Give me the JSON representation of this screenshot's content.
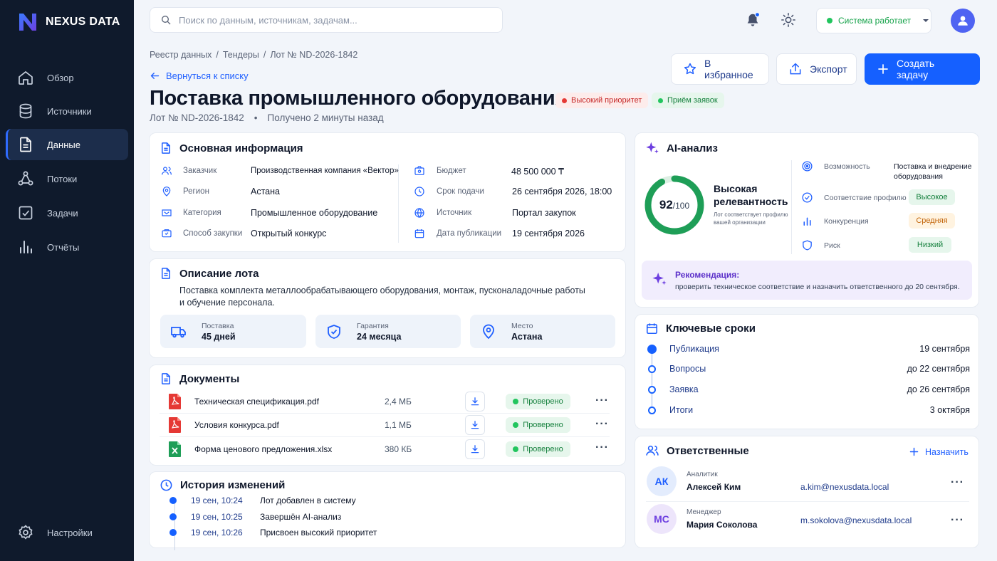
{
  "app": {
    "name": "NEXUS DATA"
  },
  "sidebar": {
    "items": [
      {
        "label": "Обзор",
        "icon": "home-icon"
      },
      {
        "label": "Источники",
        "icon": "database-icon"
      },
      {
        "label": "Данные",
        "icon": "document-icon",
        "active": true
      },
      {
        "label": "Потоки",
        "icon": "flow-icon"
      },
      {
        "label": "Задачи",
        "icon": "checkbox-icon"
      },
      {
        "label": "Отчёты",
        "icon": "bar-chart-icon"
      }
    ],
    "settings_label": "Настройки"
  },
  "topbar": {
    "search_placeholder": "Поиск по данным, источникам, задачам...",
    "system_status": "Система работает"
  },
  "header": {
    "breadcrumb": [
      "Реестр данных",
      "/",
      "Тендеры",
      "/",
      "Лот № ND-2026-1842"
    ],
    "back_label": "Вернуться к списку",
    "title": "Поставка промышленного оборудования",
    "priority_badge": "Высокий приоритет",
    "status_badge": "Приём заявок",
    "lot_number": "Лот № ND-2026-1842",
    "separator": "•",
    "received": "Получено 2 минуты назад",
    "favorite_label": "В избранное",
    "export_label": "Экспорт",
    "create_task_label": "Создать задачу"
  },
  "basic_info": {
    "title": "Основная информация",
    "left": [
      {
        "label": "Заказчик",
        "value": "Производственная компания «Вектор»",
        "icon": "user-icon"
      },
      {
        "label": "Регион",
        "value": "Астана",
        "icon": "location-icon"
      },
      {
        "label": "Категория",
        "value": "Промышленное оборудование",
        "icon": "category-icon"
      },
      {
        "label": "Способ закупки",
        "value": "Открытый конкурс",
        "icon": "procurement-icon"
      }
    ],
    "right": [
      {
        "label": "Бюджет",
        "value": "48 500 000 ₸",
        "icon": "wallet-icon"
      },
      {
        "label": "Срок подачи",
        "value": "26 сентября 2026, 18:00",
        "icon": "clock-icon"
      },
      {
        "label": "Источник",
        "value": "Портал закупок",
        "icon": "globe-icon"
      },
      {
        "label": "Дата публикации",
        "value": "19 сентября 2026",
        "icon": "calendar-icon"
      }
    ]
  },
  "lot_description": {
    "title": "Описание лота",
    "text_line1": "Поставка комплекта металлообрабатывающего оборудования, монтаж, пусконаладочные работы",
    "text_line2": "и обучение персонала.",
    "features": [
      {
        "label": "Поставка",
        "value": "45 дней",
        "icon": "truck-icon"
      },
      {
        "label": "Гарантия",
        "value": "24 месяца",
        "icon": "shield-check-icon"
      },
      {
        "label": "Место",
        "value": "Астана",
        "icon": "location-icon"
      }
    ]
  },
  "documents": {
    "title": "Документы",
    "items": [
      {
        "name": "Техническая спецификация.pdf",
        "size": "2,4 МБ",
        "status": "Проверено",
        "icon": "pdf-file-icon"
      },
      {
        "name": "Условия конкурса.pdf",
        "size": "1,1 МБ",
        "status": "Проверено",
        "icon": "pdf-file-icon"
      },
      {
        "name": "Форма ценового предложения.xlsx",
        "size": "380 КБ",
        "status": "Проверено",
        "icon": "excel-file-icon"
      }
    ],
    "more": "···"
  },
  "history": {
    "title": "История изменений",
    "items": [
      {
        "time": "19 сен, 10:24",
        "event": "Лот добавлен в систему"
      },
      {
        "time": "19 сен, 10:25",
        "event": "Завершён AI-анализ"
      },
      {
        "time": "19 сен, 10:26",
        "event": "Присвоен высокий приоритет"
      }
    ]
  },
  "ai_analysis": {
    "title": "AI-анализ",
    "score": 92,
    "score_max": "/100",
    "score_fraction": 0.92,
    "relevance_title_line1": "Высокая",
    "relevance_title_line2": "релевантность",
    "relevance_sub_line1": "Лот соответствует профилю",
    "relevance_sub_line2": "вашей организации",
    "metrics": [
      {
        "label": "Возможность",
        "value_line1": "Поставка и внедрение",
        "value_line2": "оборудования",
        "icon": "target-icon"
      },
      {
        "label": "Соответствие профилю",
        "value": "Высокое",
        "icon": "profile-match-icon",
        "tone": "#16a34a"
      },
      {
        "label": "Конкуренция",
        "value": "Средняя",
        "icon": "bar-chart-icon",
        "tone": "#d97706"
      },
      {
        "label": "Риск",
        "value": "Низкий",
        "icon": "shield-icon",
        "tone": "#16a34a"
      }
    ],
    "recommendation_title": "Рекомендация:",
    "recommendation_text": "проверить техническое соответствие и назначить ответственного до 20 сентября."
  },
  "deadlines": {
    "title": "Ключевые сроки",
    "items": [
      {
        "label": "Публикация",
        "date": "19 сентября",
        "done": true
      },
      {
        "label": "Вопросы",
        "date": "до 22 сентября",
        "done": false
      },
      {
        "label": "Заявка",
        "date": "до 26 сентября",
        "done": false
      },
      {
        "label": "Итоги",
        "date": "3 октября",
        "done": false
      }
    ]
  },
  "responsible": {
    "title": "Ответственные",
    "assign_label": "Назначить",
    "people": [
      {
        "initials": "АК",
        "role": "Аналитик",
        "name": "Алексей Ким",
        "email": "a.kim@nexusdata.local"
      },
      {
        "initials": "МС",
        "role": "Менеджер",
        "name": "Мария Соколова",
        "email": "m.sokolova@nexusdata.local"
      }
    ]
  },
  "colors": {
    "sidebar_bg": "#0f1a2c",
    "accent": "#1560ff",
    "success": "#16a34a",
    "danger": "#dc2626",
    "warning": "#d97706",
    "ai_purple": "#6d3fe0",
    "page_bg": "#f2f5fa"
  }
}
